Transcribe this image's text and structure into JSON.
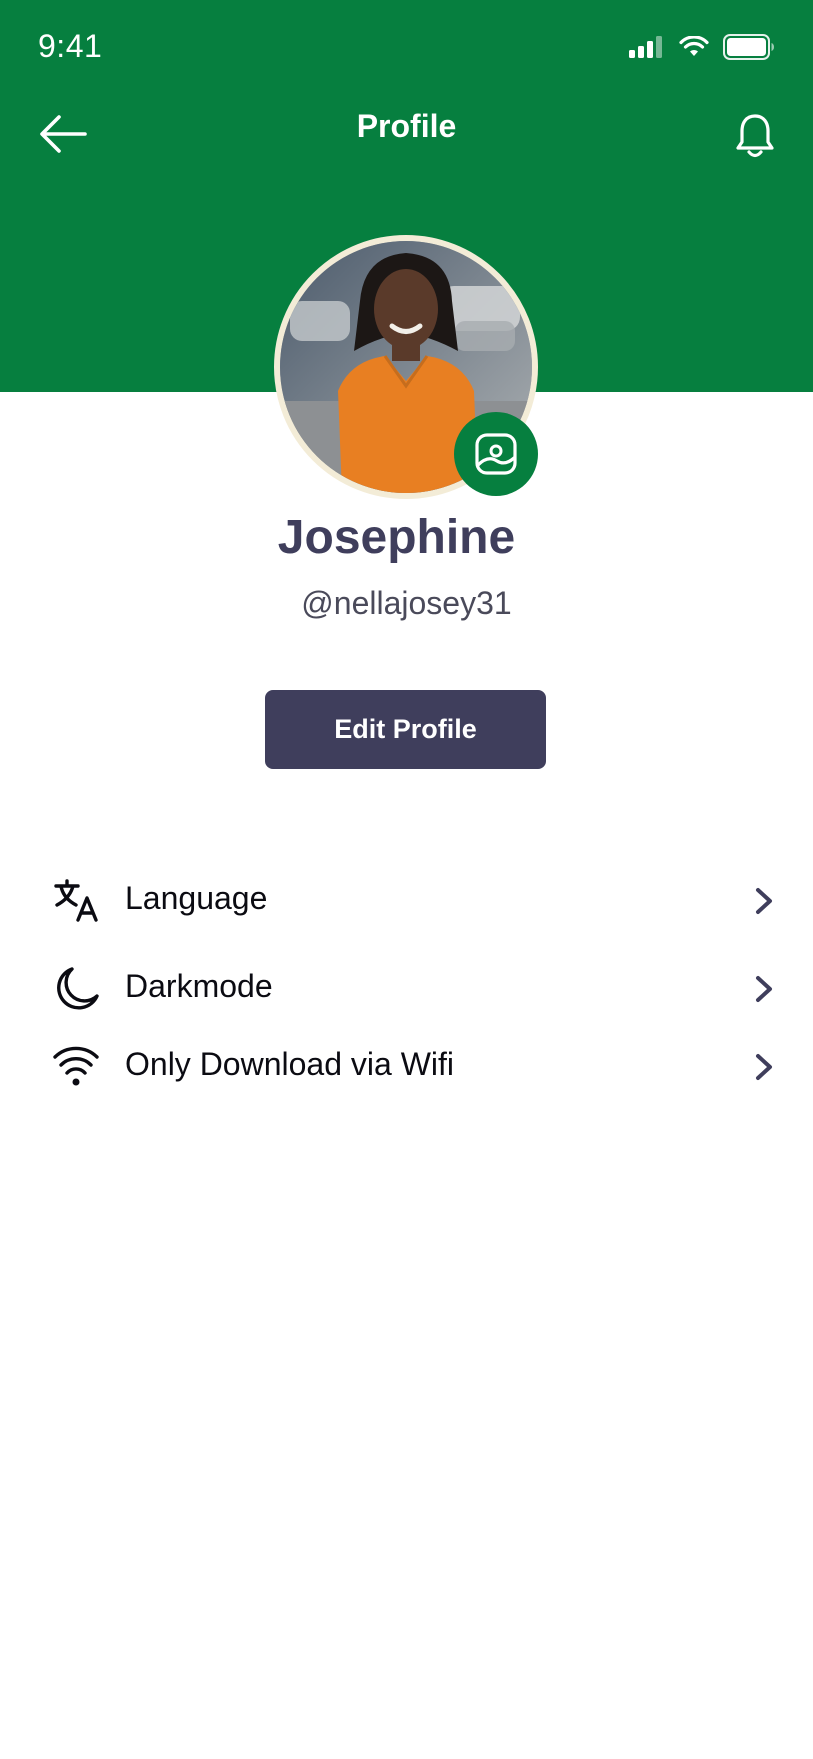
{
  "status_bar": {
    "time": "9:41"
  },
  "header": {
    "title": "Profile"
  },
  "profile": {
    "name": "Josephine",
    "handle": "@nellajosey31"
  },
  "actions": {
    "edit_profile_label": "Edit Profile"
  },
  "menu": {
    "items": [
      {
        "label": "Language",
        "icon": "translate-icon"
      },
      {
        "label": "Darkmode",
        "icon": "moon-icon"
      },
      {
        "label": "Only Download via Wifi",
        "icon": "wifi-icon"
      }
    ]
  },
  "colors": {
    "primary_green": "#067f3f",
    "button_dark": "#3f3e5c",
    "avatar_ring": "#f3ecd7"
  }
}
